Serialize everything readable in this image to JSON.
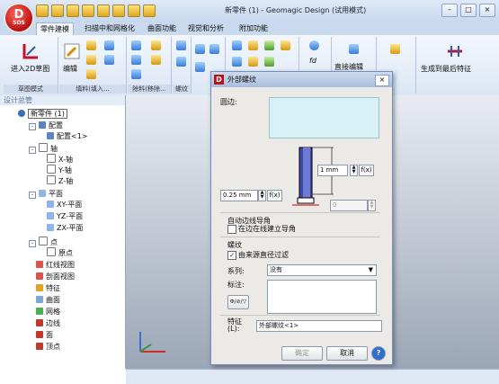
{
  "app": {
    "logo_text": "D",
    "logo_sub": "SOS",
    "window_title": "新零件 (1) - Geomagic Design (试用模式)"
  },
  "tabs": [
    "零件建模",
    "扫描中和网格化",
    "曲面功能",
    "视觉和分析",
    "附加功能"
  ],
  "ribbon": {
    "enter_2d": "进入2D草图",
    "edit": "编辑",
    "direct_edit": "直接编辑",
    "gen_feature": "生成到最后特征",
    "groups": [
      "草图模式",
      "填料(填入...",
      "除料(移除...",
      "螺纹"
    ]
  },
  "tree": {
    "title": "设计总管",
    "items": [
      {
        "label": "新零件 (1)"
      },
      {
        "label": "配置"
      },
      {
        "label": "配置<1>"
      },
      {
        "label": "轴"
      },
      {
        "label": "X-轴"
      },
      {
        "label": "Y-轴"
      },
      {
        "label": "Z-轴"
      },
      {
        "label": "平面"
      },
      {
        "label": "XY-平面"
      },
      {
        "label": "YZ-平面"
      },
      {
        "label": "ZX-平面"
      },
      {
        "label": "点"
      },
      {
        "label": "原点"
      },
      {
        "label": "红线视图"
      },
      {
        "label": "剖面视图"
      },
      {
        "label": "特征"
      },
      {
        "label": "曲面"
      },
      {
        "label": "网格"
      },
      {
        "label": "边线"
      },
      {
        "label": "面"
      },
      {
        "label": "顶点"
      }
    ]
  },
  "dialog": {
    "title": "外部螺纹",
    "edge_label": "圆边:",
    "dim_value": "1 mm",
    "offset_value": "0.25 mm",
    "disabled_value": "0",
    "auto_chamfer_title": "自动边线导角",
    "auto_chamfer_check": "在边在线建立导角",
    "thread_title": "螺纹",
    "derive_check": "由来源直径过滤",
    "series_label": "系列:",
    "series_value": "没有",
    "spec_label": "标注:",
    "feature_label": "特征\n(L):",
    "feature_value": "外部螺纹<1>",
    "ok": "确定",
    "cancel": "取消",
    "help": "?"
  }
}
